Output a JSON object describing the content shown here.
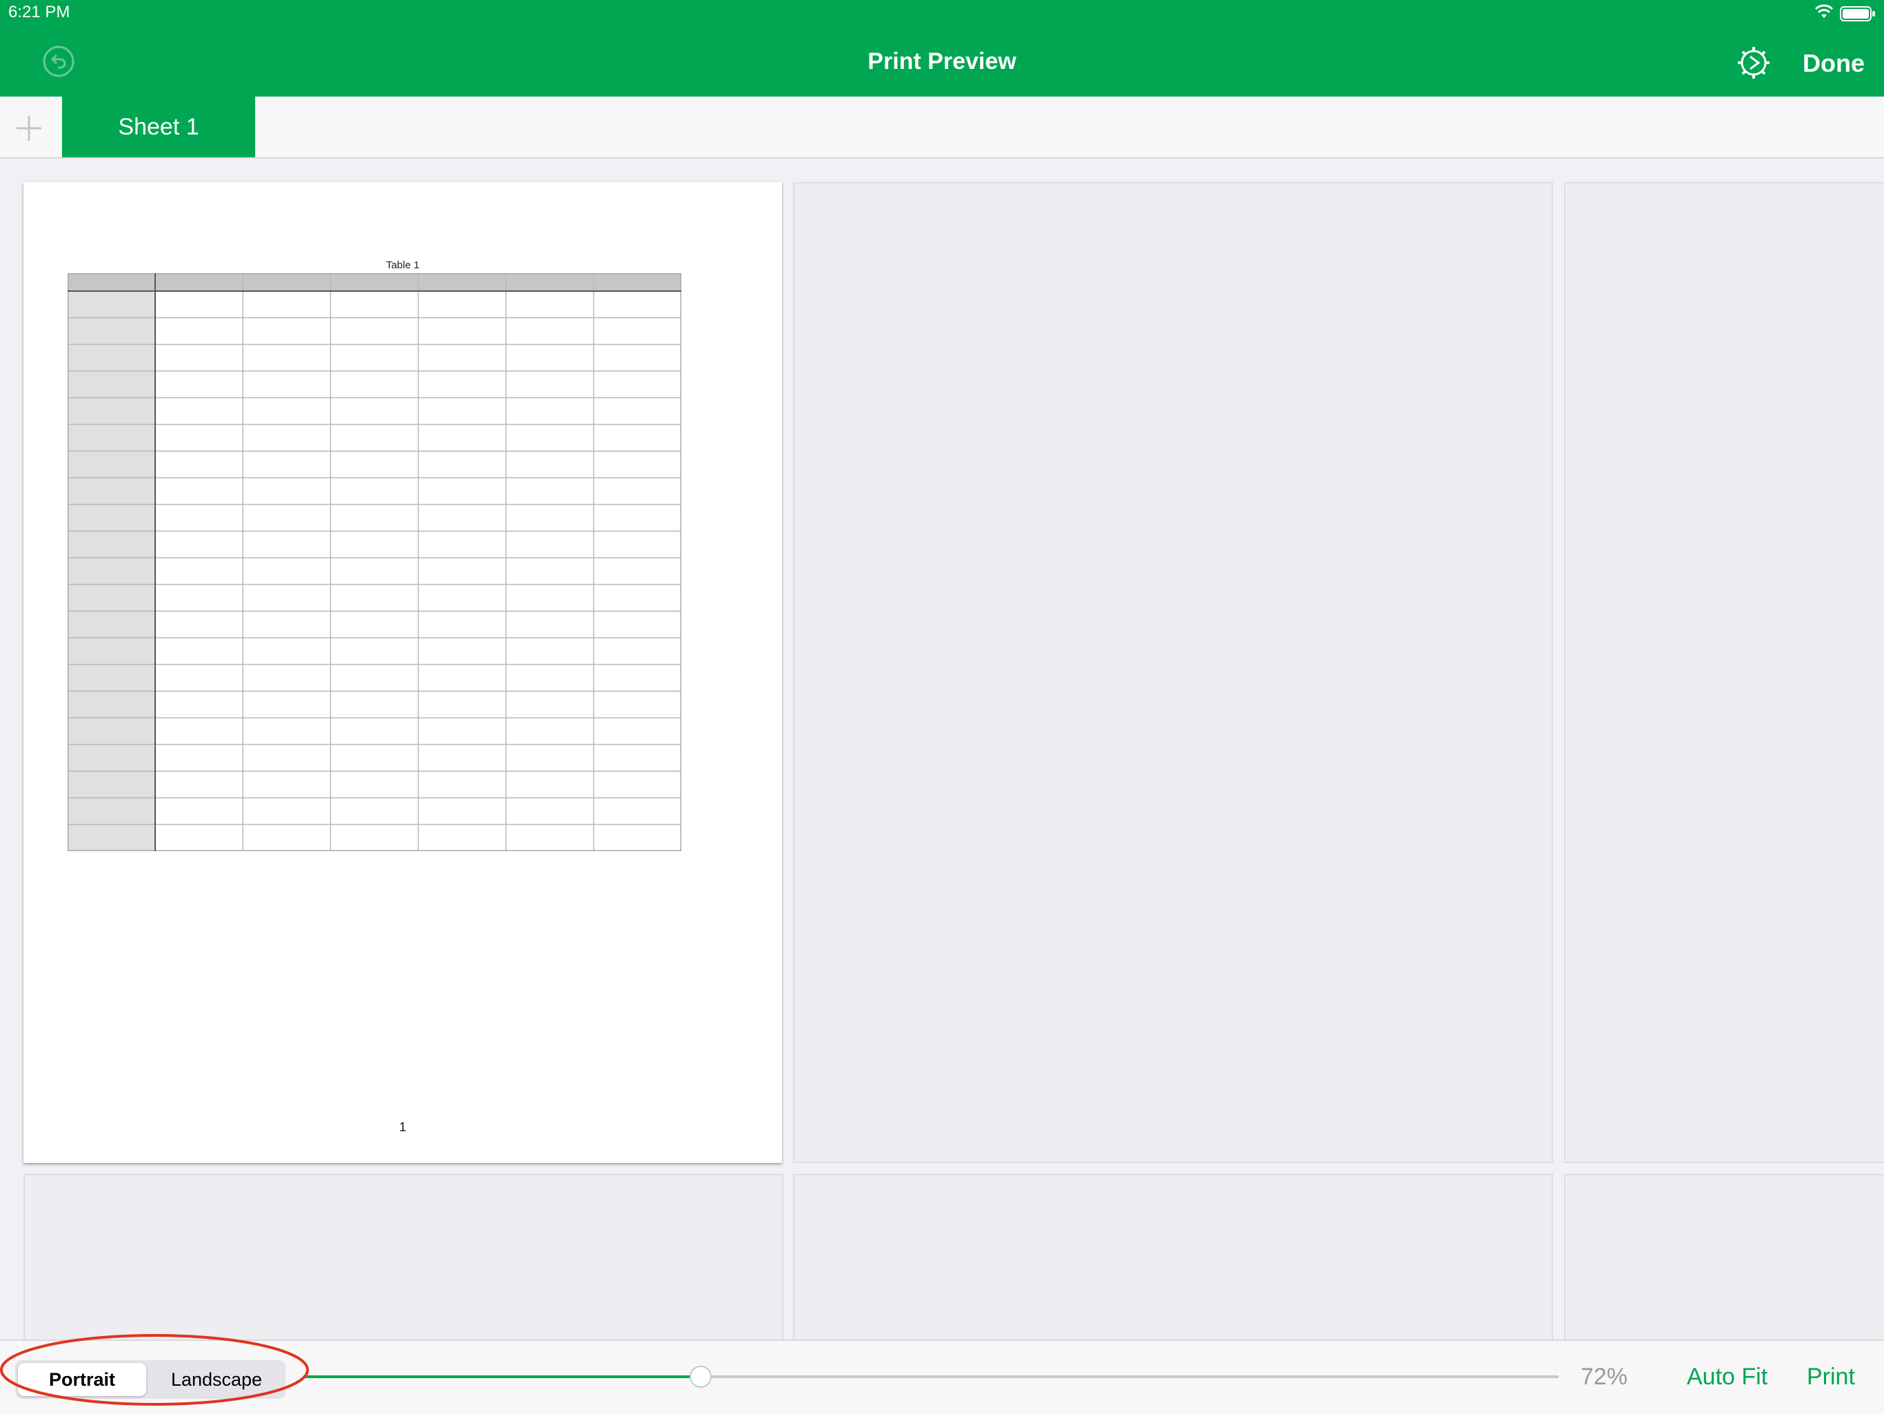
{
  "status_bar": {
    "time": "6:21 PM",
    "wifi_icon": "wifi-icon",
    "battery_icon": "battery-icon"
  },
  "nav": {
    "title": "Print Preview",
    "undo_icon": "undo-icon",
    "settings_icon": "gear-icon",
    "done_label": "Done"
  },
  "tabs": {
    "add_icon": "plus-icon",
    "sheets": [
      {
        "label": "Sheet 1",
        "selected": true
      }
    ]
  },
  "preview": {
    "page": {
      "table_title": "Table 1",
      "page_number": "1",
      "table_rows": 21,
      "table_cols": 7
    }
  },
  "toolbar": {
    "orientation_options": [
      "Portrait",
      "Landscape"
    ],
    "selected_orientation": "Portrait",
    "zoom_level": 0.72,
    "zoom_label": "72%",
    "auto_fit_label": "Auto Fit",
    "print_label": "Print"
  },
  "colors": {
    "accent": "#00a651",
    "annotation": "#e0341f",
    "background": "#f1f0f5"
  }
}
